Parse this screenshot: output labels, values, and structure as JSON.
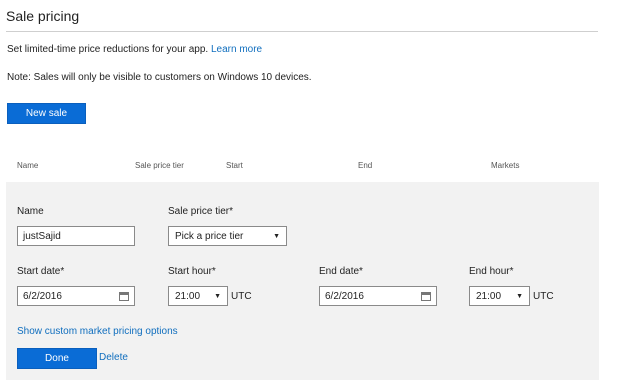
{
  "page": {
    "title": "Sale pricing",
    "description": "Set limited-time price reductions for your app.",
    "learn_more": "Learn more",
    "note": "Note: Sales will only be visible to customers on Windows 10 devices.",
    "new_sale_label": "New sale"
  },
  "table": {
    "columns": [
      "Name",
      "Sale price tier",
      "Start",
      "End",
      "Markets"
    ]
  },
  "form": {
    "name_label": "Name",
    "name_value": "justSajid",
    "tier_label": "Sale price tier*",
    "tier_value": "Pick a price tier",
    "start_date_label": "Start date*",
    "start_date_value": "6/2/2016",
    "start_hour_label": "Start hour*",
    "start_hour_value": "21:00",
    "start_tz": "UTC",
    "end_date_label": "End date*",
    "end_date_value": "6/2/2016",
    "end_hour_label": "End hour*",
    "end_hour_value": "21:00",
    "end_tz": "UTC",
    "custom_market_link": "Show custom market pricing options",
    "done_label": "Done",
    "delete_label": "Delete"
  },
  "colors": {
    "accent": "#0a6cd6",
    "link": "#106ebe",
    "panel": "#f2f2f2"
  },
  "icons": {
    "calendar": "calendar-icon",
    "dropdown": "chevron-down-icon"
  }
}
